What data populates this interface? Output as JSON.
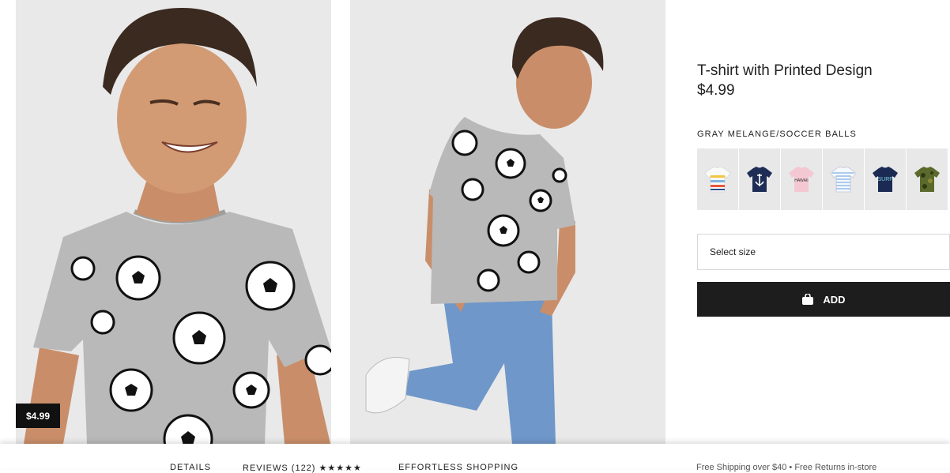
{
  "product": {
    "title": "T-shirt with Printed Design",
    "price": "$4.99",
    "price_tag": "$4.99",
    "color_name": "GRAY MELANGE/SOCCER BALLS"
  },
  "swatches": [
    {
      "name": "white striped tee",
      "print": ""
    },
    {
      "name": "navy anchor tee",
      "print": "anchor"
    },
    {
      "name": "pink hawaii tee",
      "print": "HAWAII"
    },
    {
      "name": "white blue striped tee",
      "print": ""
    },
    {
      "name": "navy surf tee",
      "print": "SURF"
    },
    {
      "name": "camo green tee",
      "print": ""
    }
  ],
  "size_select": {
    "label": "Select size"
  },
  "add_button": {
    "label": "ADD",
    "icon": "shopping-bag-icon"
  },
  "bottom_tabs": {
    "details": "DETAILS",
    "reviews": "REVIEWS (122) ★★★★★",
    "effortless": "EFFORTLESS SHOPPING",
    "shipping_note": "Free Shipping over $40 • Free Returns in-store"
  },
  "colors": {
    "add_button_bg": "#1d1d1d",
    "price_tag_bg": "#111111",
    "photo_bg": "#e9e9ea",
    "shirt_gray": "#b9b9b9"
  }
}
